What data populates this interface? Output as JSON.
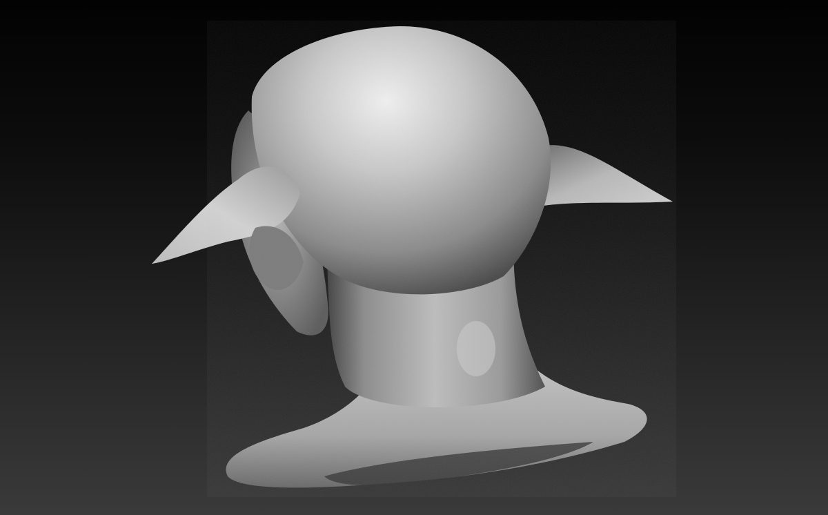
{
  "scene": {
    "subject": "sculpt-bust",
    "background_top": "#020202",
    "background_bottom": "#3a3a3a",
    "material_light": "#e6e6e6",
    "material_mid": "#8f8f8f",
    "material_dark": "#2a2a2a"
  }
}
